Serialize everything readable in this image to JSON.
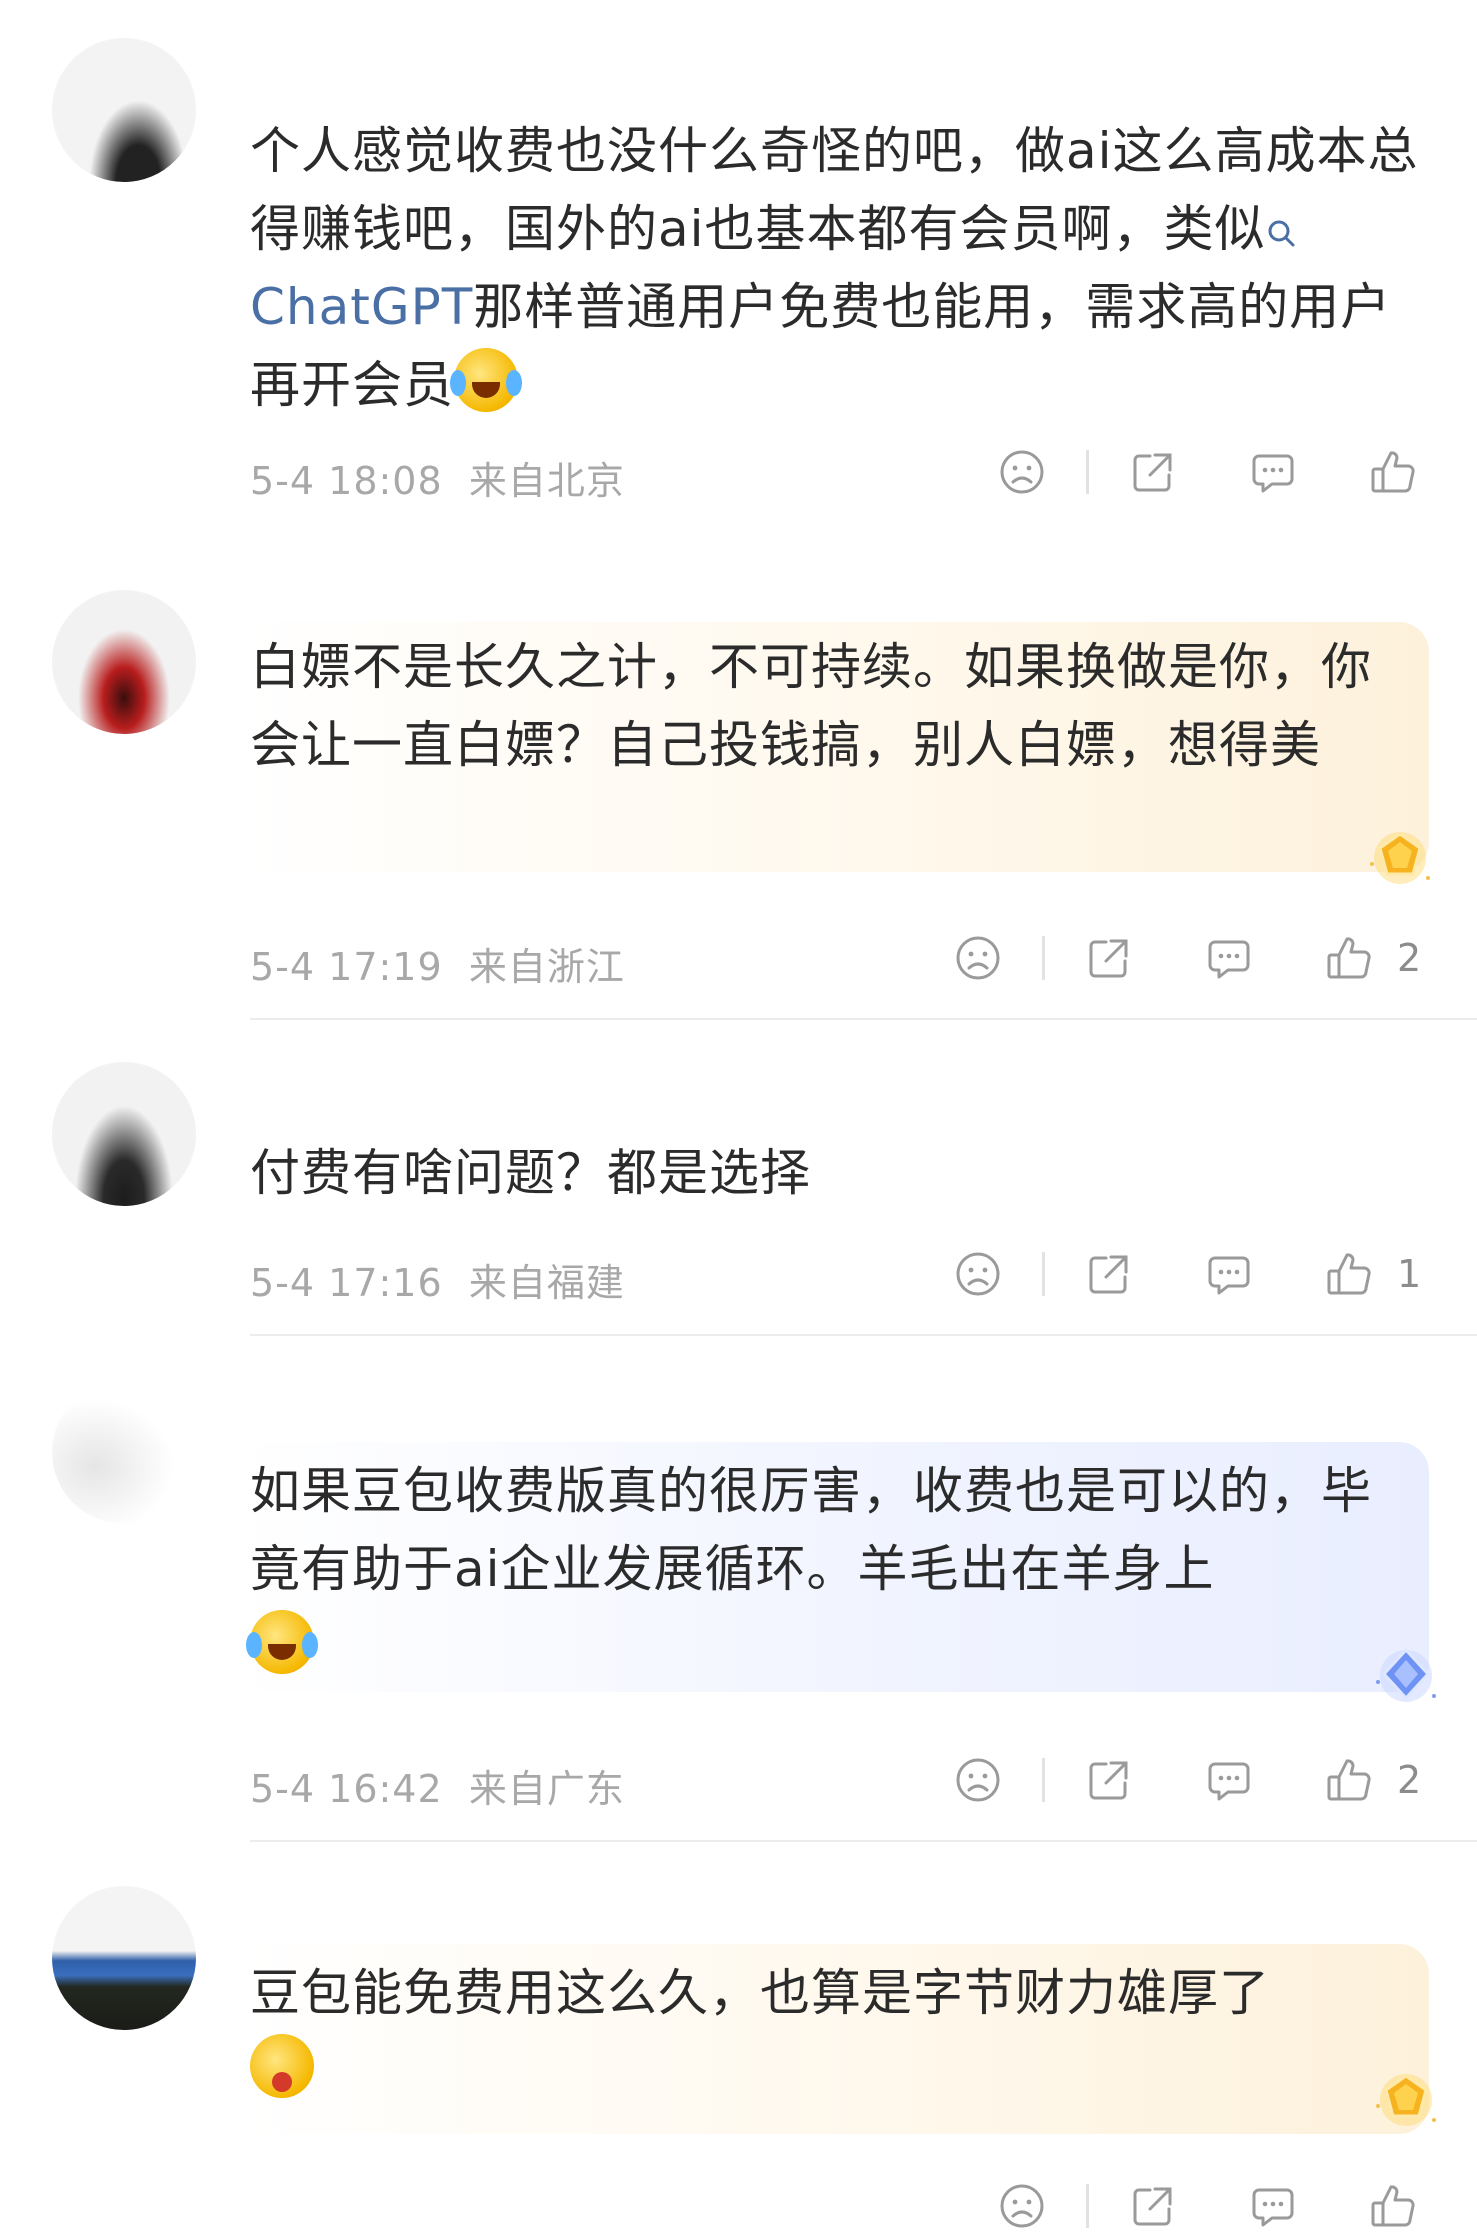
{
  "comments": [
    {
      "text_before": "个人感觉收费也没什么奇怪的吧，做ai这么高成本总得赚钱吧，国外的ai也基本都有会员啊，类似",
      "link": "ChatGPT",
      "text_after": "那样普通用户免费也能用，需求高的用户再开会员",
      "emoji": "laugh-cry-emoji",
      "time": "5-4 18:08",
      "location": "来自北京",
      "likes": ""
    },
    {
      "text": "白嫖不是长久之计，不可持续。如果换做是你，你会让一直白嫖？自己投钱搞，别人白嫖，想得美",
      "badge": "gold-gem-badge",
      "time": "5-4 17:19",
      "location": "来自浙江",
      "likes": "2"
    },
    {
      "text": "付费有啥问题？都是选择",
      "time": "5-4 17:16",
      "location": "来自福建",
      "likes": "1"
    },
    {
      "text": "如果豆包收费版真的很厉害，收费也是可以的，毕竟有助于ai企业发展循环。羊毛出在羊身上",
      "emoji": "laugh-cry-emoji",
      "badge": "blue-gem-badge",
      "time": "5-4 16:42",
      "location": "来自广东",
      "likes": "2"
    },
    {
      "text": "豆包能免费用这么久，也算是字节财力雄厚了",
      "emoji": "drooling-emoji",
      "badge": "gold-gem-badge",
      "time": "",
      "location": "",
      "likes": ""
    }
  ],
  "icons": [
    "sad-face-icon",
    "share-icon",
    "reply-icon",
    "thumbs-up-icon"
  ],
  "colors": {
    "link": "#4a6fa5",
    "meta": "#a8a8a8",
    "gold_bubble": "#fdf1db",
    "blue_bubble": "#e9eeff"
  }
}
